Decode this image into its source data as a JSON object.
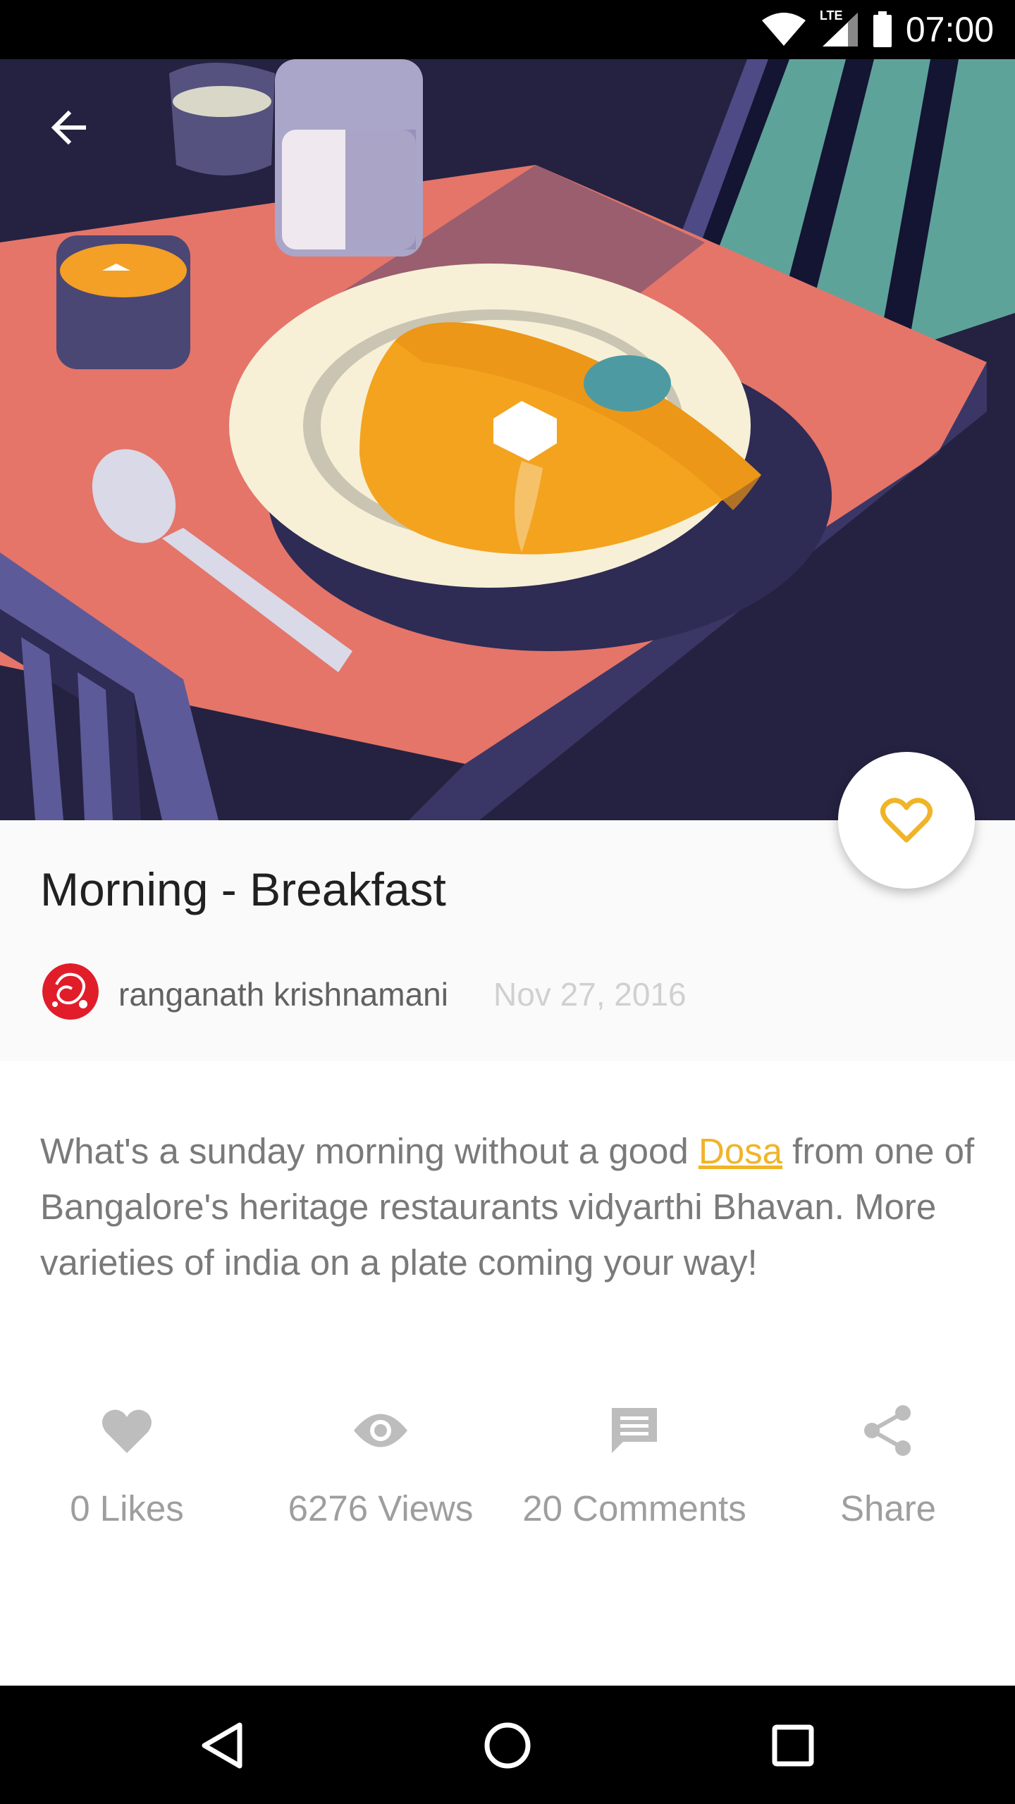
{
  "status_bar": {
    "network_label": "LTE",
    "time": "07:00"
  },
  "hero": {
    "back_icon": "arrow-left-icon",
    "illustration": "breakfast-dosa-illustration"
  },
  "post": {
    "title": "Morning - Breakfast",
    "author": "ranganath krishnamani",
    "date": "Nov 27, 2016",
    "description_before": "What's a sunday morning without a good ",
    "description_link": "Dosa",
    "description_after": " from one of Bangalore's heritage restaurants vidyarthi Bhavan. More varieties of india on a plate coming your way!"
  },
  "fab": {
    "icon": "heart-outline-icon"
  },
  "stats": {
    "likes_label": "0 Likes",
    "views_label": "6276 Views",
    "comments_label": "20 Comments",
    "share_label": "Share"
  },
  "colors": {
    "accent": "#f0b429",
    "status_bar": "#000000",
    "header_bg": "#fafafa",
    "icon_gray": "#bdbdbd"
  }
}
